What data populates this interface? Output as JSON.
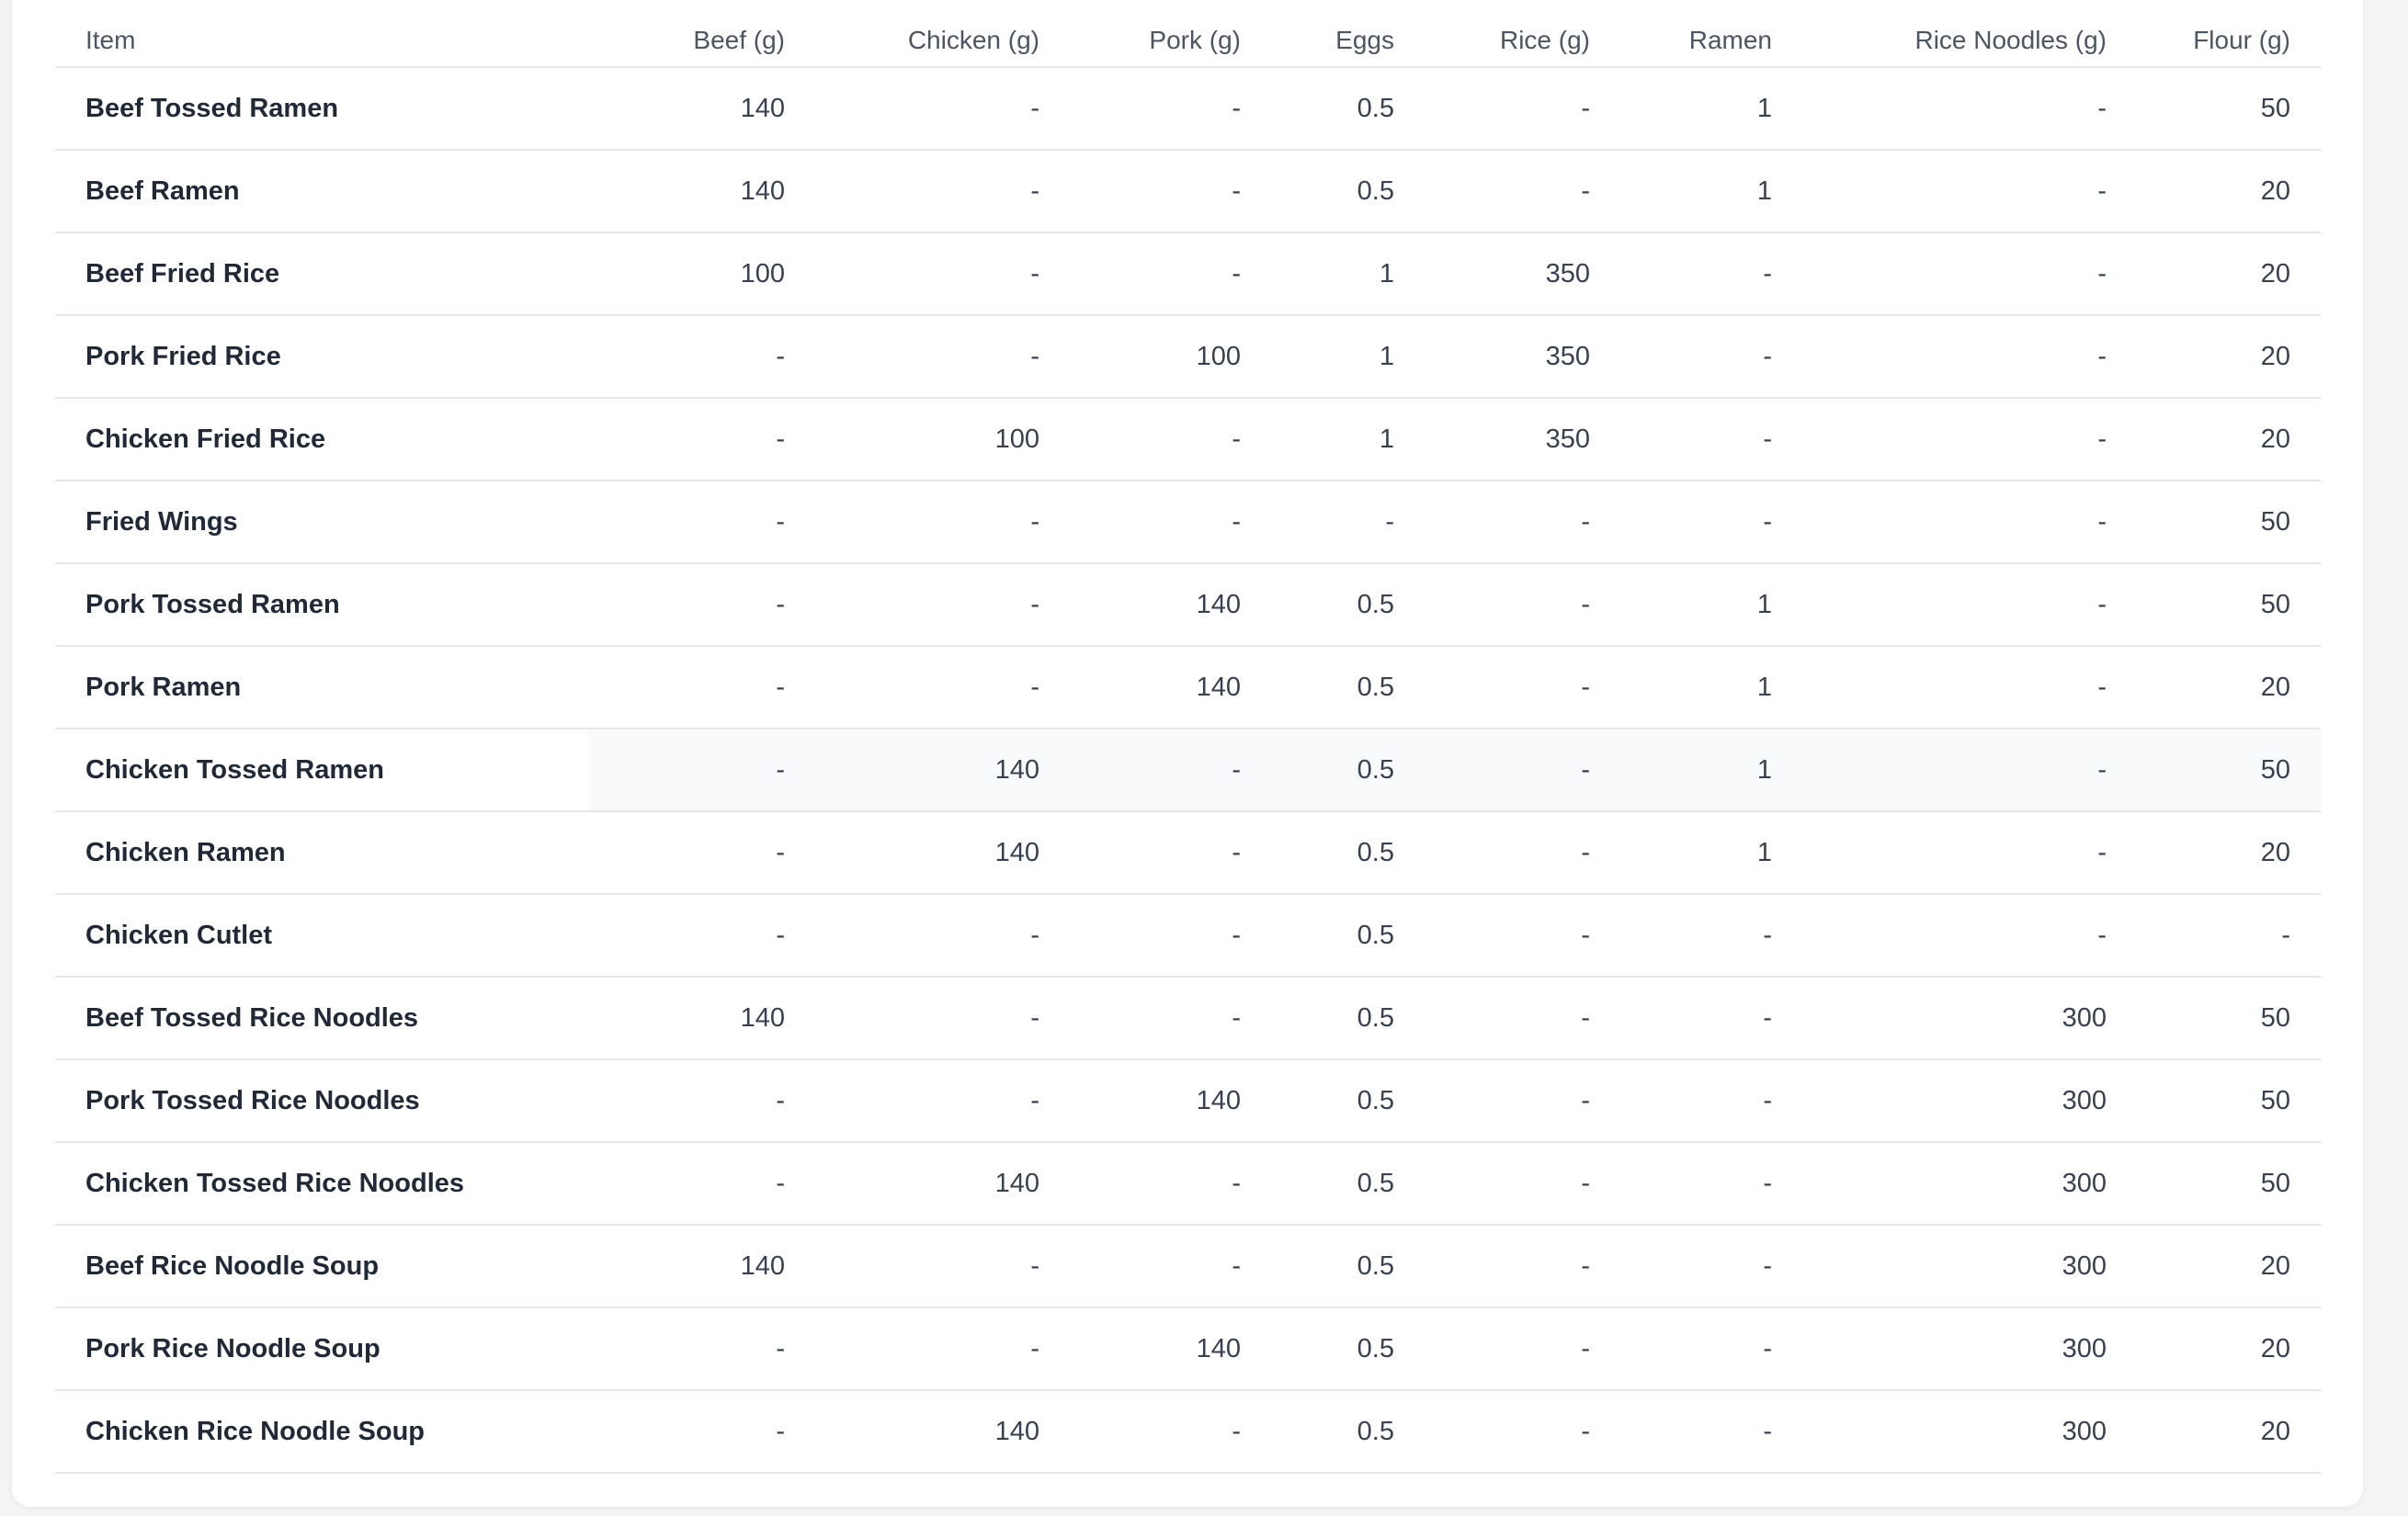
{
  "table": {
    "headers": [
      "Item",
      "Beef (g)",
      "Chicken (g)",
      "Pork (g)",
      "Eggs",
      "Rice (g)",
      "Ramen",
      "Rice Noodles (g)",
      "Flour (g)"
    ],
    "rows": [
      [
        "Beef Tossed Ramen",
        "140",
        "-",
        "-",
        "0.5",
        "-",
        "1",
        "-",
        "50"
      ],
      [
        "Beef Ramen",
        "140",
        "-",
        "-",
        "0.5",
        "-",
        "1",
        "-",
        "20"
      ],
      [
        "Beef Fried Rice",
        "100",
        "-",
        "-",
        "1",
        "350",
        "-",
        "-",
        "20"
      ],
      [
        "Pork Fried Rice",
        "-",
        "-",
        "100",
        "1",
        "350",
        "-",
        "-",
        "20"
      ],
      [
        "Chicken Fried Rice",
        "-",
        "100",
        "-",
        "1",
        "350",
        "-",
        "-",
        "20"
      ],
      [
        "Fried Wings",
        "-",
        "-",
        "-",
        "-",
        "-",
        "-",
        "-",
        "50"
      ],
      [
        "Pork Tossed Ramen",
        "-",
        "-",
        "140",
        "0.5",
        "-",
        "1",
        "-",
        "50"
      ],
      [
        "Pork Ramen",
        "-",
        "-",
        "140",
        "0.5",
        "-",
        "1",
        "-",
        "20"
      ],
      [
        "Chicken Tossed Ramen",
        "-",
        "140",
        "-",
        "0.5",
        "-",
        "1",
        "-",
        "50"
      ],
      [
        "Chicken Ramen",
        "-",
        "140",
        "-",
        "0.5",
        "-",
        "1",
        "-",
        "20"
      ],
      [
        "Chicken Cutlet",
        "-",
        "-",
        "-",
        "0.5",
        "-",
        "-",
        "-",
        "-"
      ],
      [
        "Beef Tossed Rice Noodles",
        "140",
        "-",
        "-",
        "0.5",
        "-",
        "-",
        "300",
        "50"
      ],
      [
        "Pork Tossed Rice Noodles",
        "-",
        "-",
        "140",
        "0.5",
        "-",
        "-",
        "300",
        "50"
      ],
      [
        "Chicken Tossed Rice Noodles",
        "-",
        "140",
        "-",
        "0.5",
        "-",
        "-",
        "300",
        "50"
      ],
      [
        "Beef Rice Noodle Soup",
        "140",
        "-",
        "-",
        "0.5",
        "-",
        "-",
        "300",
        "20"
      ],
      [
        "Pork Rice Noodle Soup",
        "-",
        "-",
        "140",
        "0.5",
        "-",
        "-",
        "300",
        "20"
      ],
      [
        "Chicken Rice Noodle Soup",
        "-",
        "140",
        "-",
        "0.5",
        "-",
        "-",
        "300",
        "20"
      ]
    ]
  }
}
